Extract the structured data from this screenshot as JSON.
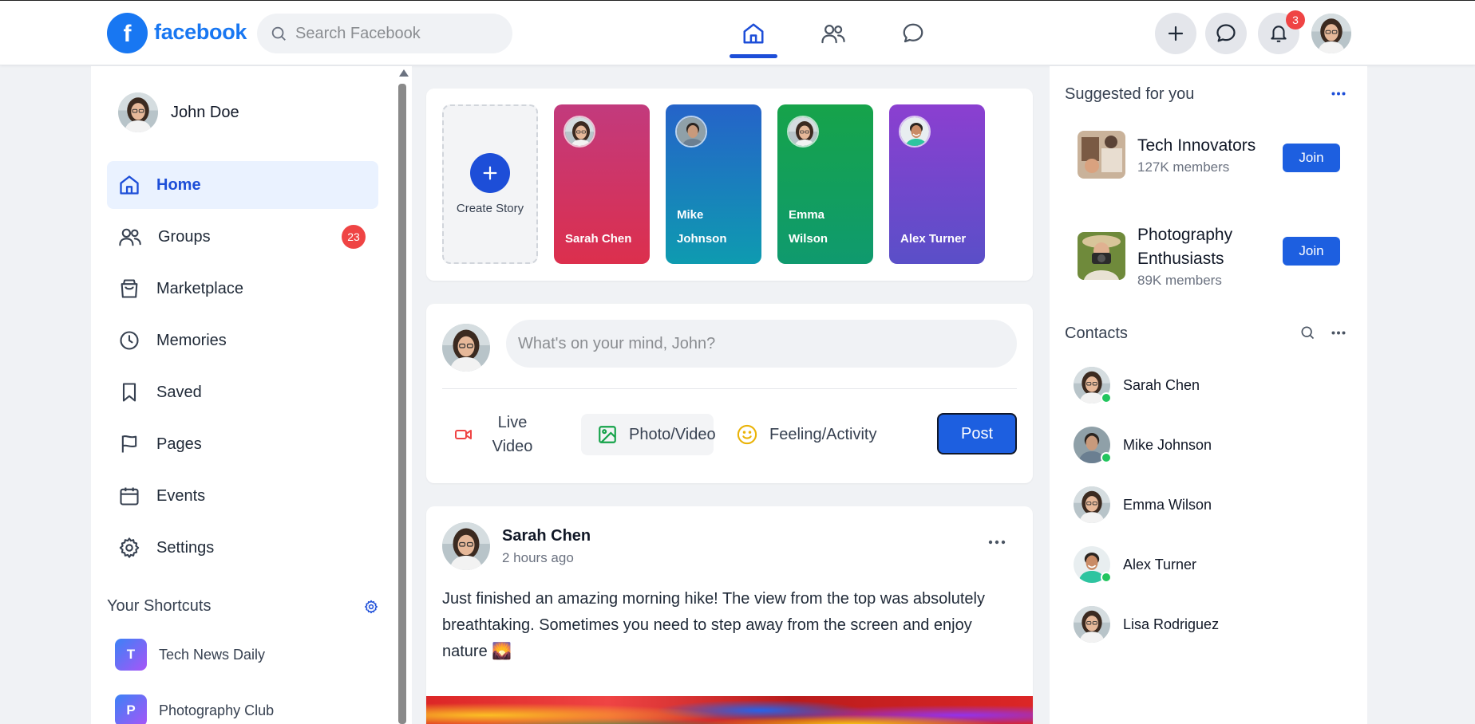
{
  "header": {
    "logo_letter": "f",
    "logo_text": "facebook",
    "search_placeholder": "Search Facebook",
    "notification_count": "3"
  },
  "profile": {
    "name": "John Doe"
  },
  "sidebar": {
    "items": [
      {
        "label": "Home",
        "icon": "home-icon",
        "active": true
      },
      {
        "label": "Groups",
        "icon": "groups-icon",
        "badge": "23"
      },
      {
        "label": "Marketplace",
        "icon": "shopping-bag-icon"
      },
      {
        "label": "Memories",
        "icon": "clock-icon"
      },
      {
        "label": "Saved",
        "icon": "bookmark-icon"
      },
      {
        "label": "Pages",
        "icon": "flag-icon"
      },
      {
        "label": "Events",
        "icon": "calendar-icon"
      },
      {
        "label": "Settings",
        "icon": "gear-icon"
      }
    ],
    "shortcuts_title": "Your Shortcuts",
    "shortcuts": [
      {
        "initial": "T",
        "label": "Tech News Daily"
      },
      {
        "initial": "P",
        "label": "Photography Club"
      }
    ]
  },
  "stories": {
    "create_label": "Create Story",
    "items": [
      {
        "name": "Sarah Chen",
        "color_top": "#c23a7d",
        "color_bottom": "#dc2f4d"
      },
      {
        "name": "Mike Johnson",
        "color_top": "#2563c9",
        "color_bottom": "#0e9bb0"
      },
      {
        "name": "Emma Wilson",
        "color_top": "#16a34a",
        "color_bottom": "#0f9a6e"
      },
      {
        "name": "Alex Turner",
        "color_top": "#8b3fd0",
        "color_bottom": "#5a4fc8"
      }
    ]
  },
  "composer": {
    "placeholder": "What's on your mind, John?",
    "live_video": "Live Video",
    "photo_video": "Photo/Video",
    "feeling_activity": "Feeling/Activity",
    "post_button": "Post"
  },
  "post": {
    "author": "Sarah Chen",
    "time": "2 hours ago",
    "text": "Just finished an amazing morning hike! The view from the top was absolutely breathtaking. Sometimes you need to step away from the screen and enjoy nature 🌄"
  },
  "suggested": {
    "title": "Suggested for you",
    "groups": [
      {
        "name": "Tech Innovators",
        "members": "127K members",
        "join_label": "Join"
      },
      {
        "name": "Photography Enthusiasts",
        "members": "89K members",
        "join_label": "Join"
      }
    ]
  },
  "contacts": {
    "title": "Contacts",
    "items": [
      {
        "name": "Sarah Chen",
        "online": true
      },
      {
        "name": "Mike Johnson",
        "online": true
      },
      {
        "name": "Emma Wilson",
        "online": false
      },
      {
        "name": "Alex Turner",
        "online": true
      },
      {
        "name": "Lisa Rodriguez",
        "online": false
      }
    ]
  },
  "colors": {
    "brand": "#1877f2",
    "primary_button": "#1d5fe0",
    "badge": "#ef4444",
    "online": "#22c55e"
  }
}
